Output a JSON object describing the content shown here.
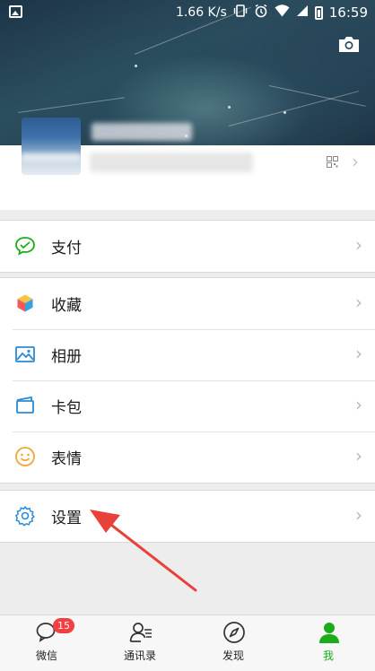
{
  "status_bar": {
    "net_speed": "1.66 K/s",
    "time": "16:59"
  },
  "profile": {
    "name_blurred": "",
    "id_blurred": ""
  },
  "menu": {
    "pay": {
      "label": "支付",
      "icon": "wechat-pay-icon",
      "color": "#1aad19"
    },
    "favorites": {
      "label": "收藏",
      "icon": "cube-icon"
    },
    "album": {
      "label": "相册",
      "icon": "photo-icon",
      "color": "#2a8bd6"
    },
    "cards": {
      "label": "卡包",
      "icon": "card-wallet-icon",
      "color": "#2a8bd6"
    },
    "stickers": {
      "label": "表情",
      "icon": "smiley-icon",
      "color": "#f0a830"
    },
    "settings": {
      "label": "设置",
      "icon": "gear-icon",
      "color": "#2a8bd6"
    }
  },
  "tabs": [
    {
      "label": "微信",
      "icon": "chat-bubbles-icon",
      "badge": "15"
    },
    {
      "label": "通讯录",
      "icon": "contacts-icon"
    },
    {
      "label": "发现",
      "icon": "compass-icon"
    },
    {
      "label": "我",
      "icon": "me-person-icon",
      "active": true
    }
  ],
  "colors": {
    "accent_green": "#1aad19",
    "badge_red": "#f23f3f",
    "annotation_red": "#e8413a"
  }
}
